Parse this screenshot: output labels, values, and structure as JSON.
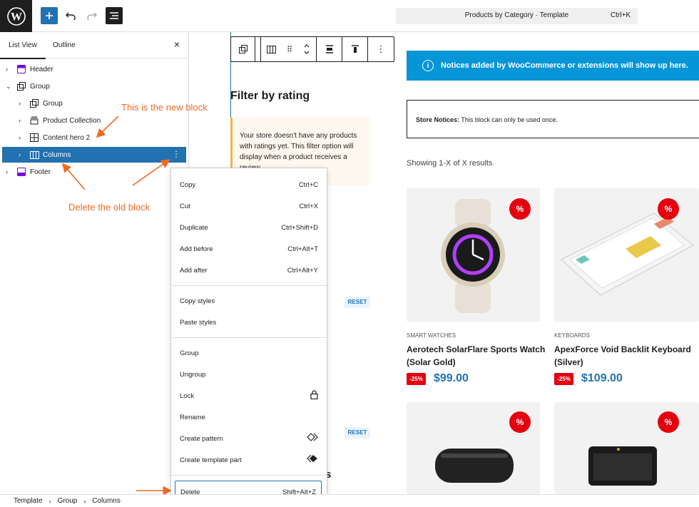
{
  "topbar": {
    "command_title": "Products by Category · Template",
    "command_shortcut": "Ctrl+K"
  },
  "sidebar": {
    "tabs": [
      {
        "label": "List View",
        "active": true
      },
      {
        "label": "Outline",
        "active": false
      }
    ],
    "close_label": "×",
    "tree": [
      {
        "label": "Header",
        "icon": "template-part-icon",
        "level": 0,
        "expanded": false
      },
      {
        "label": "Group",
        "icon": "group-icon",
        "level": 0,
        "expanded": true
      },
      {
        "label": "Group",
        "icon": "group-icon",
        "level": 1,
        "expanded": false
      },
      {
        "label": "Product Collection",
        "icon": "product-collection-icon",
        "level": 1,
        "expanded": false
      },
      {
        "label": "Content hero 2",
        "icon": "table-grid-icon",
        "level": 1,
        "expanded": false
      },
      {
        "label": "Columns",
        "icon": "columns-icon",
        "level": 1,
        "expanded": false,
        "selected": true
      },
      {
        "label": "Footer",
        "icon": "footer-icon",
        "level": 0,
        "expanded": false
      }
    ]
  },
  "annotations": {
    "new_block": "This is the new block",
    "delete_old": "Delete the old block"
  },
  "canvas": {
    "filter_title": "Filter by rating",
    "filter_notice": "Your store doesn't have any products with ratings yet. This filter option will display when a product receives a review.",
    "reset_label": "RESET",
    "partial_heading": "s",
    "woo_notice": "Notices added by WooCommerce or extensions will show up here.",
    "store_notices_bold": "Store Notices:",
    "store_notices_text": " This block can only be used once.",
    "showing": "Showing 1-X of X results",
    "products": [
      {
        "category": "SMART WATCHES",
        "name": "Aerotech SolarFlare Sports Watch (Solar Gold)",
        "discount": "-25%",
        "price": "$99.00",
        "badge": "%"
      },
      {
        "category": "KEYBOARDS",
        "name": "ApexForce Void Backlit Keyboard (Silver)",
        "discount": "-25%",
        "price": "$109.00",
        "badge": "%"
      },
      {
        "badge": "%"
      },
      {
        "badge": "%"
      }
    ]
  },
  "context_menu": {
    "groups": [
      [
        {
          "label": "Copy",
          "shortcut": "Ctrl+C"
        },
        {
          "label": "Cut",
          "shortcut": "Ctrl+X"
        },
        {
          "label": "Duplicate",
          "shortcut": "Ctrl+Shift+D"
        },
        {
          "label": "Add before",
          "shortcut": "Ctrl+Alt+T"
        },
        {
          "label": "Add after",
          "shortcut": "Ctrl+Alt+Y"
        }
      ],
      [
        {
          "label": "Copy styles"
        },
        {
          "label": "Paste styles"
        }
      ],
      [
        {
          "label": "Group"
        },
        {
          "label": "Ungroup"
        },
        {
          "label": "Lock",
          "icon": "lock-icon"
        },
        {
          "label": "Rename"
        },
        {
          "label": "Create pattern",
          "icon": "pattern-icon"
        },
        {
          "label": "Create template part",
          "icon": "template-part-icon"
        }
      ],
      [
        {
          "label": "Delete",
          "shortcut": "Shift+Alt+Z"
        }
      ]
    ]
  },
  "breadcrumb": [
    "Template",
    "Group",
    "Columns"
  ],
  "colors": {
    "accent": "#2271b1",
    "annotation": "#f26a21",
    "notice_blue": "#0696d7",
    "sale_red": "#e4000f"
  }
}
